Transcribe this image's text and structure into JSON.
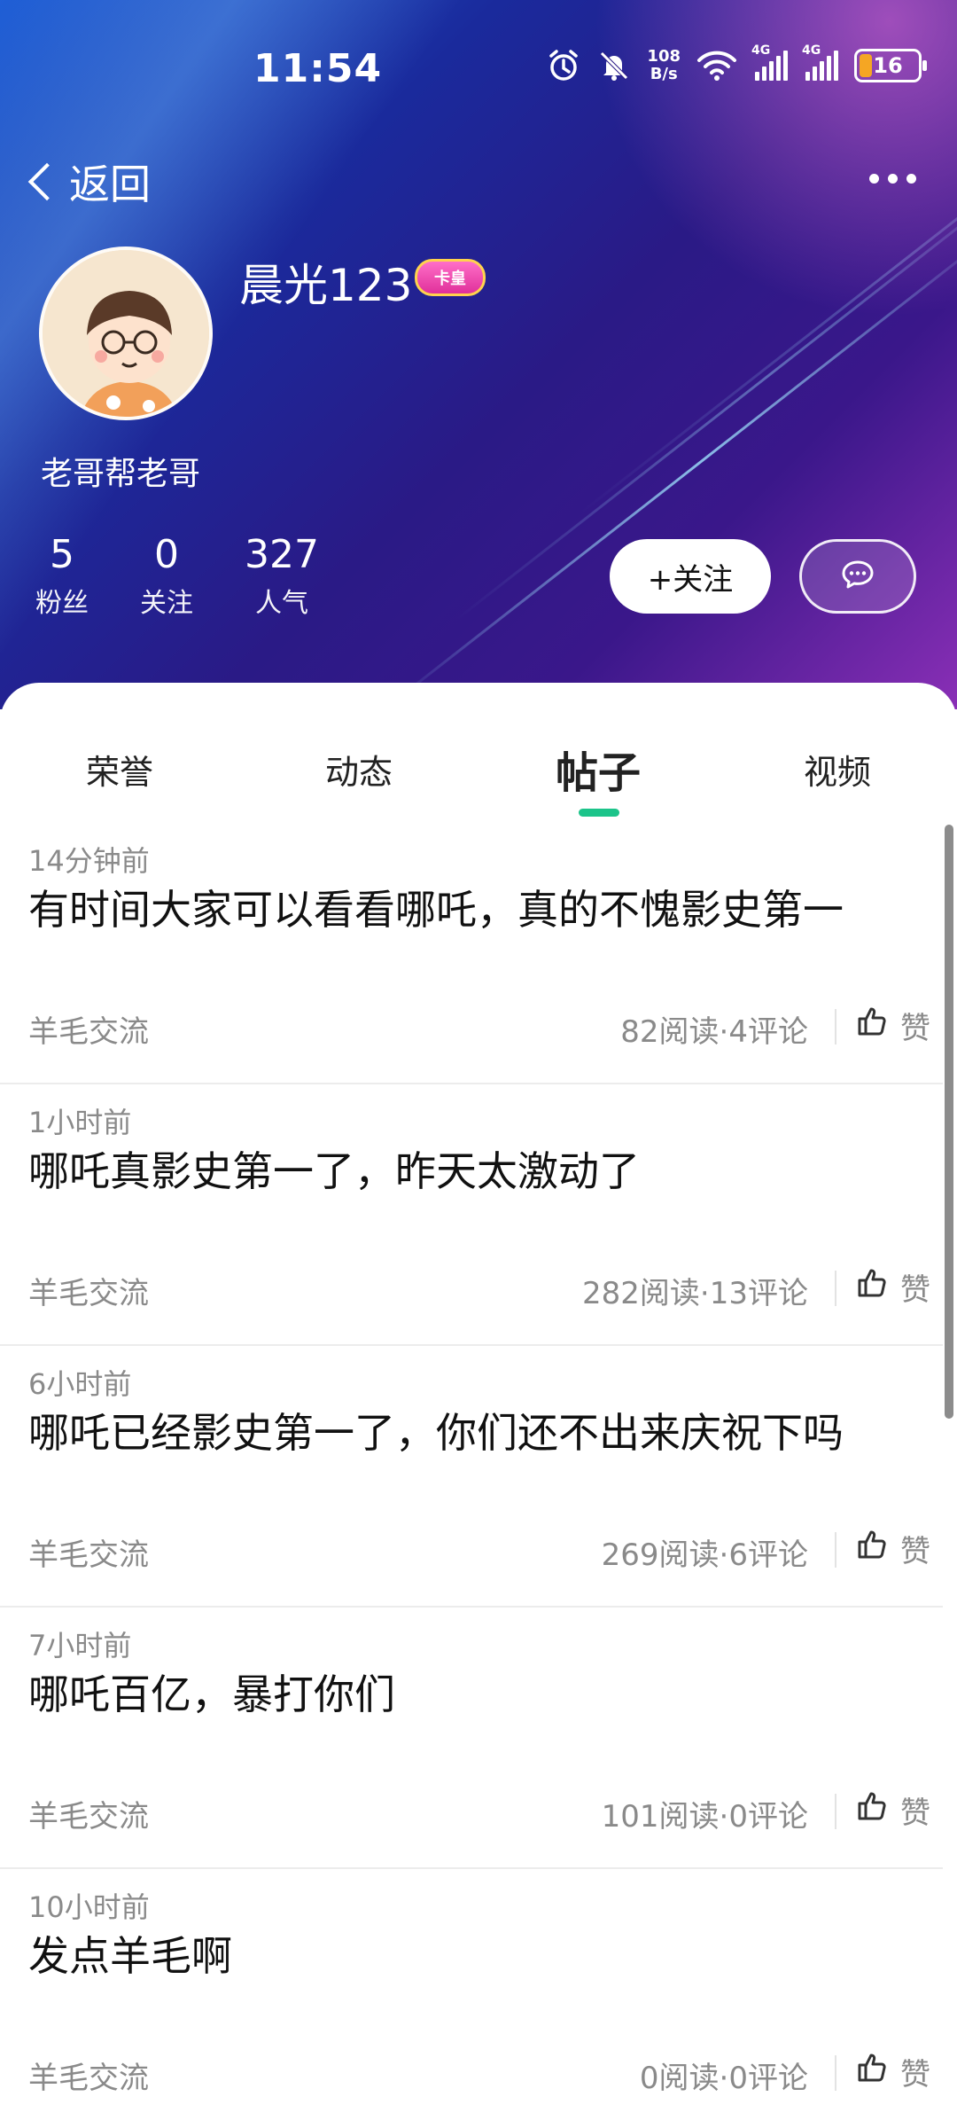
{
  "status_bar": {
    "time": "11:54",
    "net_speed_top": "108",
    "net_speed_bottom": "B/s",
    "signal1_label": "4G",
    "signal2_label": "4G",
    "battery_level": "16"
  },
  "nav": {
    "back_label": "返回"
  },
  "profile": {
    "username": "晨光123",
    "badge": "卡皇",
    "signature": "老哥帮老哥",
    "stats": [
      {
        "value": "5",
        "label": "粉丝"
      },
      {
        "value": "0",
        "label": "关注"
      },
      {
        "value": "327",
        "label": "人气"
      }
    ],
    "follow_label": "+关注"
  },
  "tabs": [
    {
      "label": "荣誉",
      "active": false
    },
    {
      "label": "动态",
      "active": false
    },
    {
      "label": "帖子",
      "active": true
    },
    {
      "label": "视频",
      "active": false
    }
  ],
  "posts": [
    {
      "time": "14分钟前",
      "title": "有时间大家可以看看哪吒，真的不愧影史第一",
      "category": "羊毛交流",
      "meta": "82阅读·4评论",
      "like": "赞"
    },
    {
      "time": "1小时前",
      "title": "哪吒真影史第一了，昨天太激动了",
      "category": "羊毛交流",
      "meta": "282阅读·13评论",
      "like": "赞"
    },
    {
      "time": "6小时前",
      "title": "哪吒已经影史第一了，你们还不出来庆祝下吗",
      "category": "羊毛交流",
      "meta": "269阅读·6评论",
      "like": "赞"
    },
    {
      "time": "7小时前",
      "title": "哪吒百亿，暴打你们",
      "category": "羊毛交流",
      "meta": "101阅读·0评论",
      "like": "赞"
    },
    {
      "time": "10小时前",
      "title": "发点羊毛啊",
      "category": "羊毛交流",
      "meta": "0阅读·0评论",
      "like": "赞"
    }
  ],
  "icons": {
    "alarm": "alarm-icon",
    "mute": "bell-off-icon",
    "wifi": "wifi-icon",
    "more": "more-icon",
    "message": "message-icon",
    "like": "thumbs-up-icon"
  },
  "colors": {
    "accent": "#1cc48a",
    "muted_text": "#8a8a8a"
  }
}
